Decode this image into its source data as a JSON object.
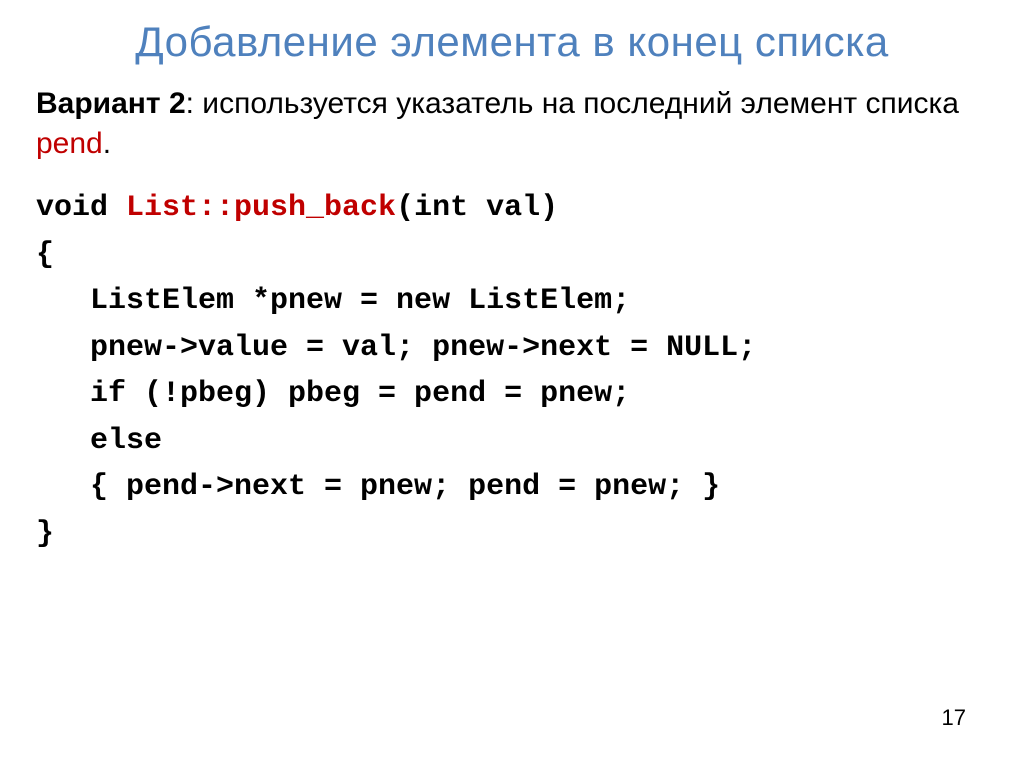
{
  "title": "Добавление элемента в конец списка",
  "paragraph": {
    "bold": "Вариант 2",
    "rest1": ": используется указатель на последний элемент списка  ",
    "pend": "pend",
    "rest2": "."
  },
  "code": {
    "sig_void": "void ",
    "sig_name": "List::push_back",
    "sig_params": "(int val)",
    "open_brace": "{",
    "l1": "   ListElem *pnew = new ListElem;",
    "l2": "   pnew->value = val; pnew->next = NULL;",
    "l3": "   if (!pbeg) pbeg = pend = pnew;",
    "l4": "   else",
    "l5": "   { pend->next = pnew; pend = pnew; }",
    "close_brace": "}"
  },
  "page_number": "17"
}
